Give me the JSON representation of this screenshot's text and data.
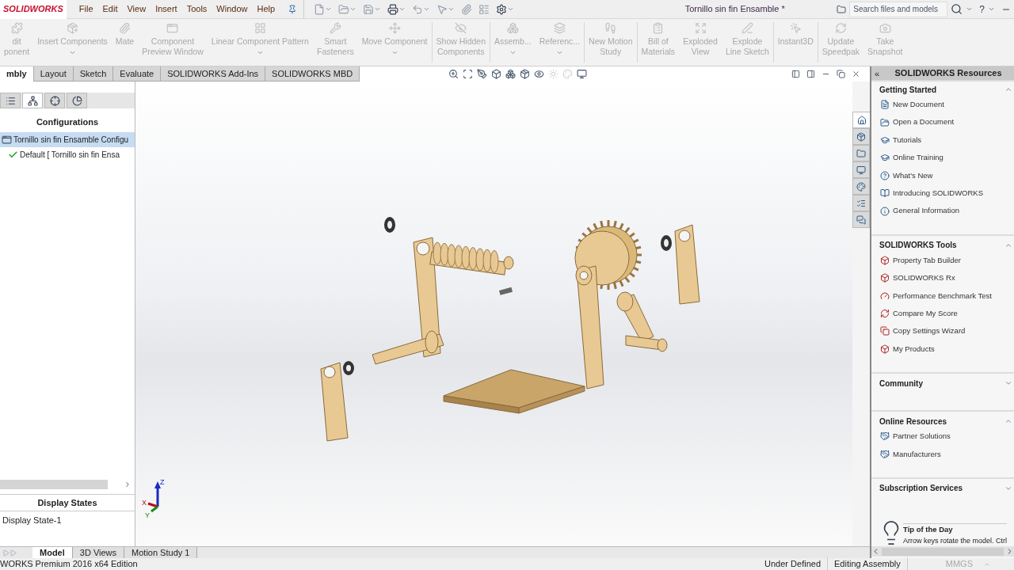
{
  "app": {
    "logo": "SOLIDWORKS",
    "menus": [
      "File",
      "Edit",
      "View",
      "Insert",
      "Tools",
      "Window",
      "Help"
    ],
    "title": "Tornillo sin fin Ensamble *",
    "search": {
      "placeholder": "Search files and models"
    },
    "help": "?"
  },
  "commands": [
    {
      "lines": [
        "dit",
        "ponent"
      ],
      "disabled": true,
      "dropdown": false
    },
    {
      "lines": [
        "Insert Components"
      ],
      "disabled": true,
      "dropdown": true
    },
    {
      "lines": [
        "Mate"
      ],
      "disabled": true,
      "dropdown": false
    },
    {
      "lines": [
        "Component",
        "Preview Window"
      ],
      "disabled": true,
      "dropdown": false
    },
    {
      "lines": [
        "Linear Component Pattern"
      ],
      "disabled": true,
      "dropdown": true
    },
    {
      "lines": [
        "Smart",
        "Fasteners"
      ],
      "disabled": true,
      "dropdown": false
    },
    {
      "lines": [
        "Move Component"
      ],
      "disabled": true,
      "dropdown": true
    },
    {
      "lines": [
        "Show Hidden",
        "Components"
      ],
      "disabled": true,
      "dropdown": false
    },
    {
      "lines": [
        "Assemb..."
      ],
      "disabled": true,
      "dropdown": true
    },
    {
      "lines": [
        "Referenc..."
      ],
      "disabled": true,
      "dropdown": true
    },
    {
      "lines": [
        "New Motion",
        "Study"
      ],
      "disabled": true,
      "dropdown": false
    },
    {
      "lines": [
        "Bill of",
        "Materials"
      ],
      "disabled": true,
      "dropdown": false
    },
    {
      "lines": [
        "Exploded",
        "View"
      ],
      "disabled": true,
      "dropdown": false
    },
    {
      "lines": [
        "Explode",
        "Line Sketch"
      ],
      "disabled": true,
      "dropdown": false
    },
    {
      "lines": [
        "Instant3D"
      ],
      "disabled": true,
      "dropdown": false
    },
    {
      "lines": [
        "Update",
        "Speedpak"
      ],
      "disabled": true,
      "dropdown": false
    },
    {
      "lines": [
        "Take",
        "Snapshot"
      ],
      "disabled": true,
      "dropdown": false
    }
  ],
  "tabs": [
    {
      "label": "mbly",
      "selected": true
    },
    {
      "label": "Layout",
      "selected": false
    },
    {
      "label": "Sketch",
      "selected": false
    },
    {
      "label": "Evaluate",
      "selected": false
    },
    {
      "label": "SOLIDWORKS Add-Ins",
      "selected": false
    },
    {
      "label": "SOLIDWORKS MBD",
      "selected": false
    }
  ],
  "left_panel": {
    "tabs": [
      {
        "selected": false
      },
      {
        "selected": true
      },
      {
        "selected": false
      },
      {
        "selected": false
      }
    ],
    "heading": "Configurations",
    "tree": [
      {
        "label": "Tornillo sin fin Ensamble Configu",
        "selected": true,
        "children": [
          {
            "label": "Default [ Tornillo sin fin Ensa",
            "selected": false,
            "active": true
          }
        ]
      }
    ],
    "display_heading": "Display States",
    "display_states": [
      "Display State-1"
    ]
  },
  "triad": {
    "axes": [
      "Z",
      "X",
      "Y"
    ]
  },
  "task_tabs": [
    {
      "selected": true
    },
    {
      "selected": false
    },
    {
      "selected": false
    },
    {
      "selected": false
    },
    {
      "selected": false
    },
    {
      "selected": false
    },
    {
      "selected": false
    }
  ],
  "resources": {
    "collapse": "«",
    "title": "SOLIDWORKS Resources",
    "sections": [
      {
        "title": "Getting Started",
        "expanded": true,
        "items": [
          "New Document",
          "Open a Document",
          "Tutorials",
          "Online Training",
          "What's New",
          "Introducing SOLIDWORKS",
          "General Information"
        ]
      },
      {
        "title": "SOLIDWORKS Tools",
        "expanded": true,
        "items": [
          "Property Tab Builder",
          "SOLIDWORKS Rx",
          "Performance Benchmark Test",
          "Compare My Score",
          "Copy Settings Wizard",
          "My Products"
        ]
      },
      {
        "title": "Community",
        "expanded": false
      },
      {
        "title": "Online Resources",
        "expanded": true,
        "items": [
          "Partner Solutions",
          "Manufacturers"
        ]
      },
      {
        "title": "Subscription Services",
        "expanded": false
      }
    ],
    "tip": {
      "title": "Tip of the Day",
      "text": "Arrow keys rotate the model. Ctrl"
    }
  },
  "bottom_tabs": [
    {
      "label": "Model",
      "selected": true
    },
    {
      "label": "3D Views",
      "selected": false
    },
    {
      "label": "Motion Study 1",
      "selected": false
    }
  ],
  "status": {
    "edition": "WORKS Premium 2016 x64 Edition",
    "items": [
      "Under Defined",
      "Editing Assembly"
    ],
    "units": "MMGS"
  }
}
